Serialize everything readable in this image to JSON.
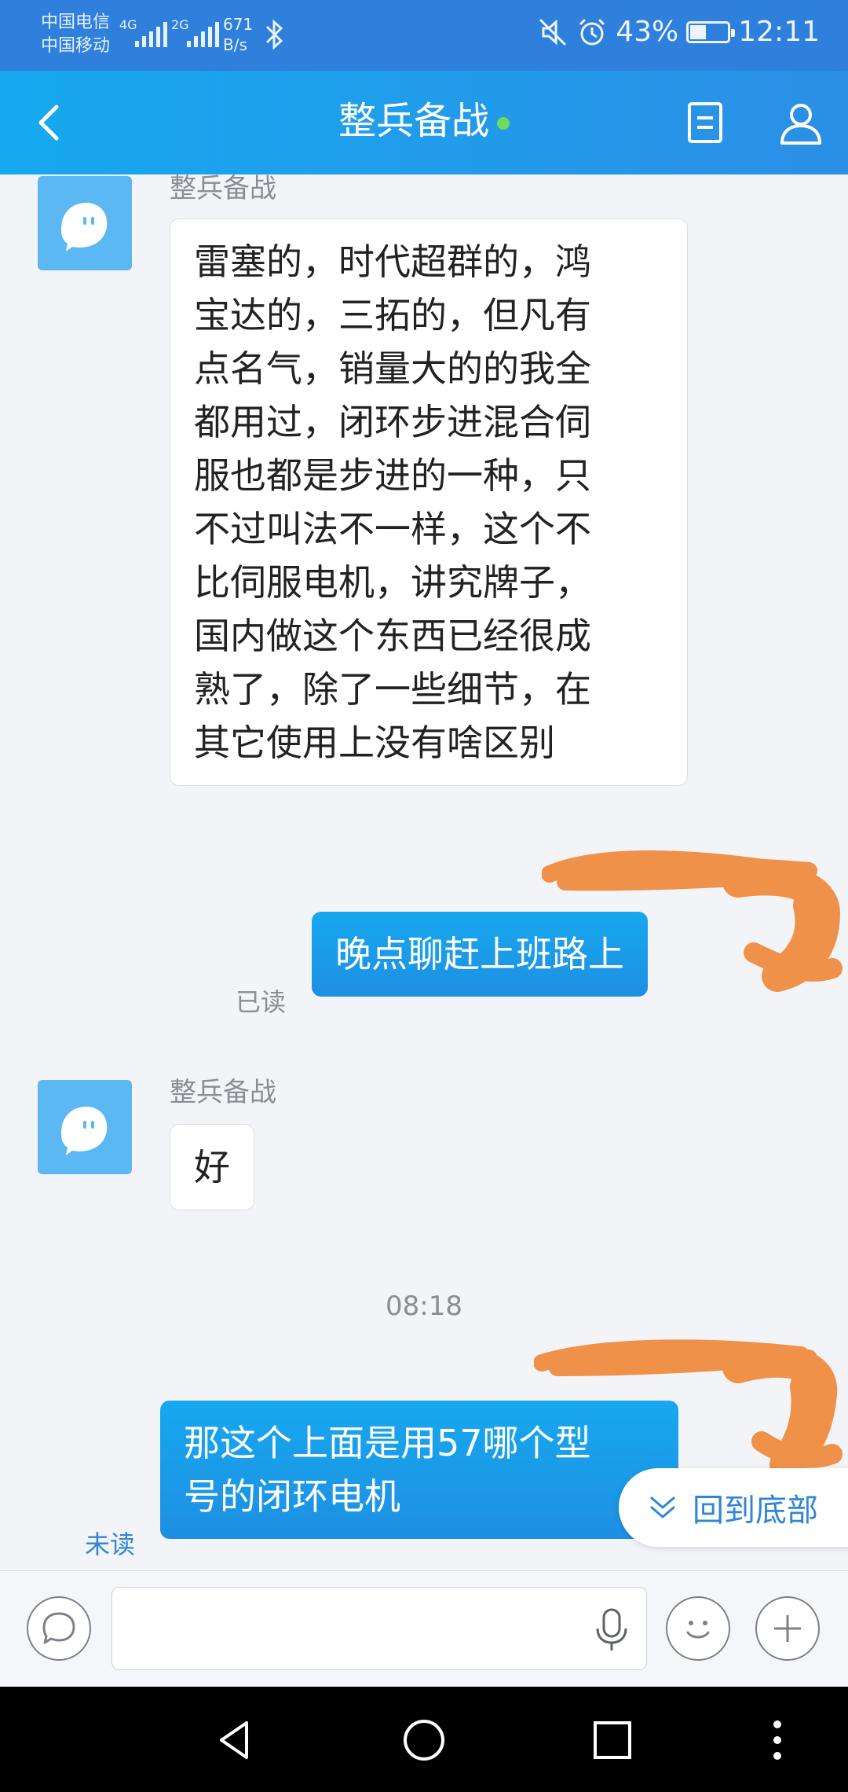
{
  "status_bar": {
    "carrier_1": "中国电信",
    "carrier_2": "中国移动",
    "network_1": "4G",
    "network_2": "2G",
    "speed_value": "671",
    "speed_unit": "B/s",
    "battery": "43%",
    "battery_level": 0.43,
    "time": "12:11",
    "icons": [
      "signal-icon",
      "bluetooth-icon",
      "mute-icon",
      "alarm-icon",
      "battery-icon"
    ]
  },
  "header": {
    "title": "整兵备战",
    "online": true,
    "icons": [
      "back-icon",
      "document-icon",
      "profile-icon"
    ]
  },
  "messages": [
    {
      "sender": "整兵备战",
      "text_lines": [
        "雷塞的，时代超群的，鸿",
        "宝达的，三拓的，但凡有",
        "点名气，销量大的的我全",
        "都用过，闭环步进混合伺",
        "服也都是步进的一种，只",
        "不过叫法不一样，这个不",
        "比伺服电机，讲究牌子，",
        "国内做这个东西已经很成",
        "熟了，除了一些细节，在",
        "其它使用上没有啥区别"
      ]
    },
    {
      "text": "晚点聊赶上班路上",
      "status": "已读"
    },
    {
      "sender": "整兵备战",
      "text": "好"
    },
    {
      "time": "08:18"
    },
    {
      "text_lines": [
        "那这个上面是用57哪个型",
        "号的闭环电机"
      ],
      "status": "未读"
    }
  ],
  "scroll_button": {
    "label": "回到底部"
  },
  "input_bar": {
    "icons": [
      "chat-bubble-icon",
      "mic-icon",
      "emoji-icon",
      "plus-icon"
    ]
  },
  "nav_bar": {
    "icons": [
      "back-triangle-icon",
      "home-circle-icon",
      "recents-square-icon",
      "menu-dots-icon"
    ]
  },
  "colors": {
    "accent": "#1e9be8",
    "online": "#6edc5a",
    "unread": "#2f86d6",
    "scribble": "#f0914a"
  }
}
